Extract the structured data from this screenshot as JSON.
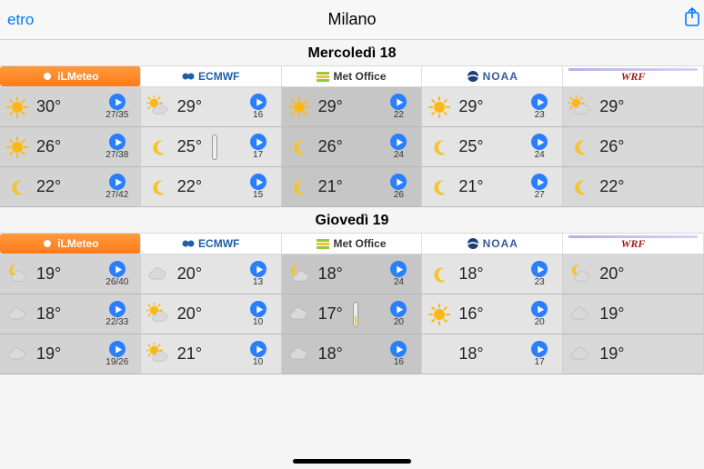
{
  "topbar": {
    "back": "etro",
    "title": "Milano"
  },
  "providers": [
    "iLMeteo",
    "ECMWF",
    "Met Office",
    "NOAA",
    "WRF"
  ],
  "days": [
    {
      "label": "Mercoledì 18",
      "cols": [
        {
          "rows": [
            {
              "icon": "sun",
              "temp": "30°",
              "wind": "27/35"
            },
            {
              "icon": "sun",
              "temp": "26°",
              "wind": "27/38"
            },
            {
              "icon": "moon",
              "temp": "22°",
              "wind": "27/42"
            }
          ]
        },
        {
          "rows": [
            {
              "icon": "suncloud",
              "temp": "29°",
              "wind": "16"
            },
            {
              "icon": "moon",
              "temp": "25°",
              "wind": "17",
              "thermo": true
            },
            {
              "icon": "moon",
              "temp": "22°",
              "wind": "15"
            }
          ]
        },
        {
          "rows": [
            {
              "icon": "sun",
              "temp": "29°",
              "wind": "22"
            },
            {
              "icon": "moon",
              "temp": "26°",
              "wind": "24"
            },
            {
              "icon": "moon",
              "temp": "21°",
              "wind": "26"
            }
          ]
        },
        {
          "rows": [
            {
              "icon": "sun",
              "temp": "29°",
              "wind": "23"
            },
            {
              "icon": "moon",
              "temp": "25°",
              "wind": "24"
            },
            {
              "icon": "moon",
              "temp": "21°",
              "wind": "27"
            }
          ]
        },
        {
          "rows": [
            {
              "icon": "suncloud",
              "temp": "29°"
            },
            {
              "icon": "moon",
              "temp": "26°"
            },
            {
              "icon": "moon",
              "temp": "22°"
            }
          ]
        }
      ]
    },
    {
      "label": "Giovedì 19",
      "cols": [
        {
          "rows": [
            {
              "icon": "mooncloud",
              "temp": "19°",
              "wind": "26/40"
            },
            {
              "icon": "cloud",
              "temp": "18°",
              "wind": "22/33"
            },
            {
              "icon": "cloud",
              "temp": "19°",
              "wind": "19/26"
            }
          ]
        },
        {
          "rows": [
            {
              "icon": "cloud",
              "temp": "20°",
              "wind": "13"
            },
            {
              "icon": "suncloud",
              "temp": "20°",
              "wind": "10"
            },
            {
              "icon": "suncloud",
              "temp": "21°",
              "wind": "10"
            }
          ]
        },
        {
          "rows": [
            {
              "icon": "mooncloud",
              "temp": "18°",
              "wind": "24"
            },
            {
              "icon": "cloud",
              "temp": "17°",
              "wind": "20",
              "thermo": "warm"
            },
            {
              "icon": "cloud",
              "temp": "18°",
              "wind": "16"
            }
          ]
        },
        {
          "rows": [
            {
              "icon": "moon",
              "temp": "18°",
              "wind": "23"
            },
            {
              "icon": "sun",
              "temp": "16°",
              "wind": "20"
            },
            {
              "icon": "",
              "temp": "18°",
              "wind": "17"
            }
          ]
        },
        {
          "rows": [
            {
              "icon": "mooncloud",
              "temp": "20°"
            },
            {
              "icon": "cloud",
              "temp": "19°"
            },
            {
              "icon": "cloud",
              "temp": "19°"
            }
          ]
        }
      ]
    }
  ]
}
